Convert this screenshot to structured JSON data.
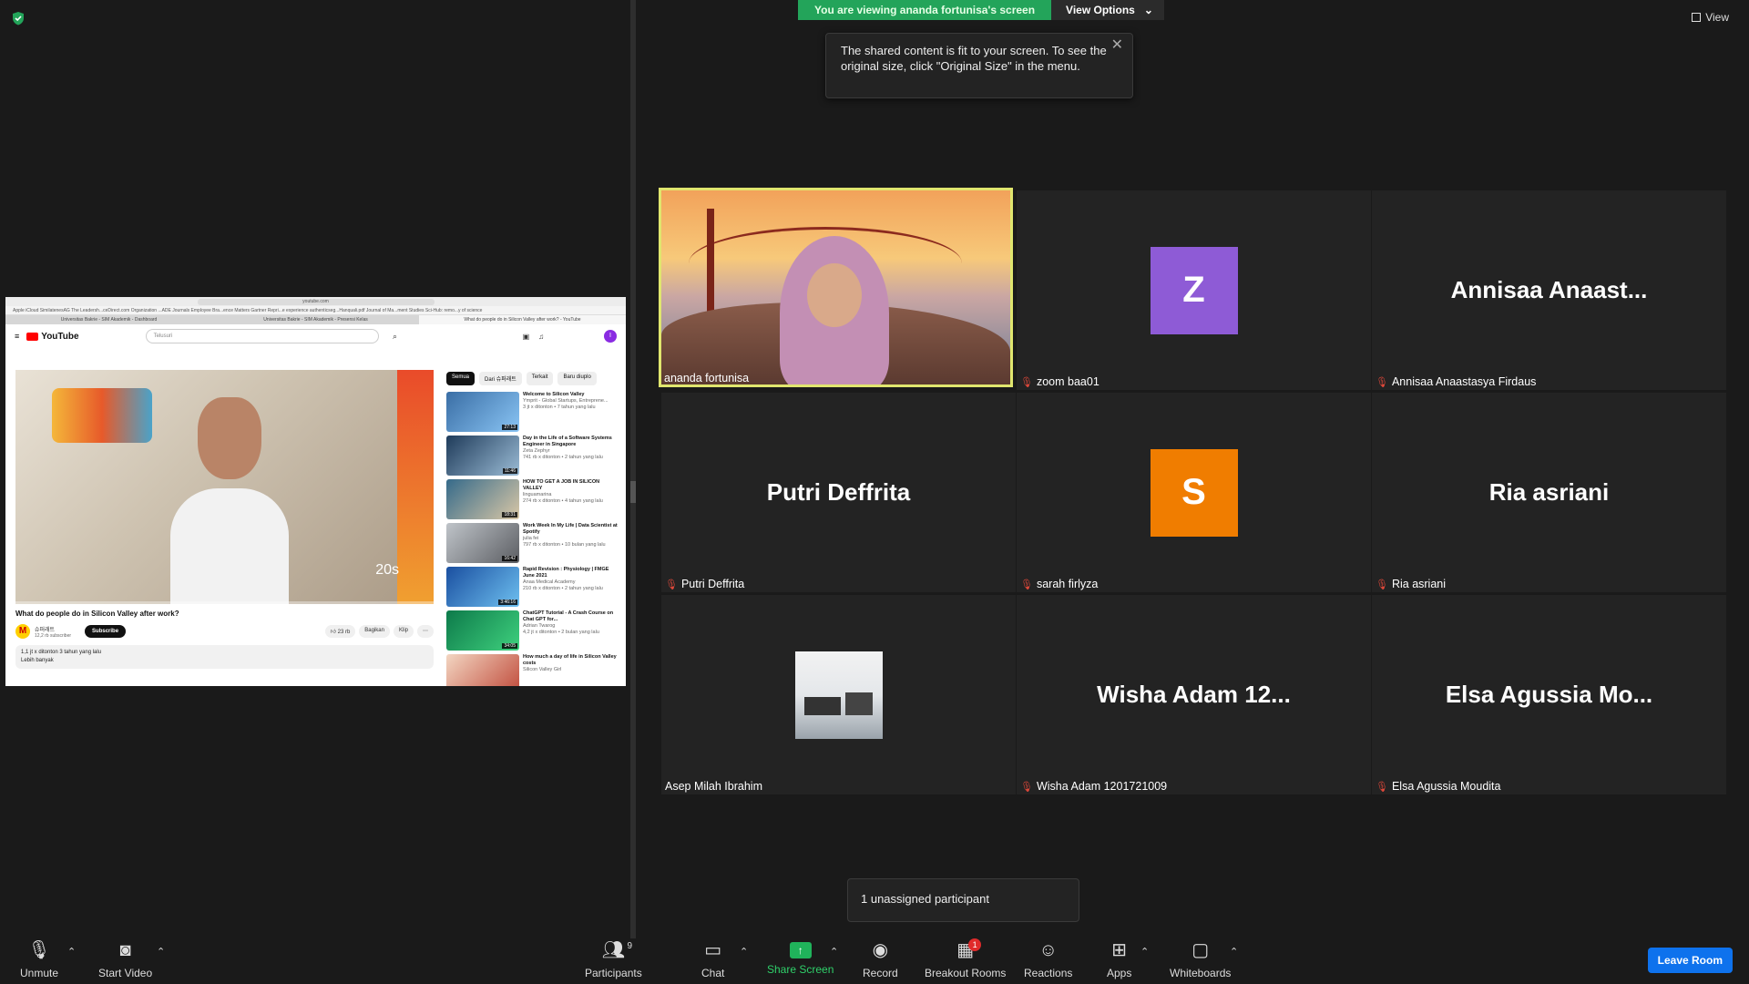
{
  "banner": {
    "viewing_text": "You are viewing ananda fortunisa's screen",
    "view_options_label": "View Options",
    "view_label": "View"
  },
  "tooltip": {
    "text": "The shared content is fit to your screen. To see the original size, click \"Original Size\" in the menu."
  },
  "shared_screen": {
    "url": "youtube.com",
    "bookmarks": "Apple   iCloud   SimilatenesAG   The Leadersh...ceDirect.com   Organization ...ADE Journals   Employee Bra...ence Matters   Gartner Repri...e experience   authenticseg...Hanquali.pdf   Journal of Ma...ment Studies   Sci-Hub: remo...y of science",
    "tabs": [
      "Universitas Bakrie - SIM Akademik - Dashboard",
      "Universitas Bakrie - SIM Akademik - Presensi Kelas",
      "What do people do in Silicon Valley after work? - YouTube"
    ],
    "yt_logo": "YouTube",
    "search_placeholder": "Telusuri",
    "avatar_letter": "I",
    "video_timer": "20s",
    "video_title": "What do people do in Silicon Valley after work?",
    "channel_name": "슈퍼래트",
    "channel_subs": "12,2 rb subscriber",
    "subscribe_label": "Subscribe",
    "likes": "23 rb",
    "share_label": "Bagikan",
    "clip_label": "Klip",
    "views_line": "1,1 jt x ditonton  3 tahun yang lalu",
    "more_label": "Lebih banyak",
    "chips": [
      "Semua",
      "Dari 슈퍼래트",
      "Terkait",
      "Baru diuplo"
    ],
    "recommendations": [
      {
        "title": "Welcome to Silicon Valley",
        "channel": "Ymprit - Global Startups, Entreprene...",
        "meta": "3 jt x ditonton • 7 tahun yang lalu",
        "duration": "27:13"
      },
      {
        "title": "Day in the Life of a Software Systems Engineer in Singapore",
        "channel": "Zeta Zephyr",
        "meta": "741 rb x ditonton • 2 tahun yang lalu",
        "duration": "11:46"
      },
      {
        "title": "HOW TO GET A JOB IN SILICON VALLEY",
        "channel": "linguamarina",
        "meta": "274 rb x ditonton • 4 tahun yang lalu",
        "duration": "18:31"
      },
      {
        "title": "Work Week In My Life | Data Scientist at Spotify",
        "channel": "julia fei",
        "meta": "797 rb x ditonton • 10 bulan yang lalu",
        "duration": "16:42"
      },
      {
        "title": "Rapid Revision : Physiology | FMGE June 2021",
        "channel": "Anaa Medical Academy",
        "meta": "210 rb x ditonton • 2 tahun yang lalu",
        "duration": "3:46:16"
      },
      {
        "title": "ChatGPT Tutorial - A Crash Course on Chat GPT for...",
        "channel": "Adrian Twarog",
        "meta": "4,2 jt x ditonton • 2 bulan yang lalu",
        "duration": "34:05"
      },
      {
        "title": "How much a day of life in Silicon Valley costs",
        "channel": "Silicon Valley Girl",
        "meta": "",
        "duration": ""
      }
    ]
  },
  "participants": [
    {
      "display": "",
      "name": "ananda fortunisa",
      "type": "camera",
      "muted": false
    },
    {
      "display": "Z",
      "name": "zoom baa01",
      "type": "avatar",
      "color": "#8e5bd6",
      "muted": true
    },
    {
      "display": "Annisaa  Anaast...",
      "name": "Annisaa Anaastasya Firdaus",
      "type": "text",
      "muted": true
    },
    {
      "display": "Putri Deffrita",
      "name": "Putri Deffrita",
      "type": "text",
      "muted": true
    },
    {
      "display": "S",
      "name": "sarah firlyza",
      "type": "avatar",
      "color": "#f07d00",
      "muted": true
    },
    {
      "display": "Ria asriani",
      "name": "Ria asriani",
      "type": "text",
      "muted": true
    },
    {
      "display": "",
      "name": "Asep Milah Ibrahim",
      "type": "photo",
      "muted": false
    },
    {
      "display": "Wisha Adam 12...",
      "name": "Wisha Adam 1201721009",
      "type": "text",
      "muted": true
    },
    {
      "display": "Elsa Agussia Mo...",
      "name": "Elsa Agussia Moudita",
      "type": "text",
      "muted": true
    }
  ],
  "unassigned": "1 unassigned participant",
  "toolbar": {
    "unmute": "Unmute",
    "start_video": "Start Video",
    "participants": "Participants",
    "participants_count": "9",
    "chat": "Chat",
    "share_screen": "Share Screen",
    "record": "Record",
    "breakout_rooms": "Breakout Rooms",
    "breakout_badge": "1",
    "reactions": "Reactions",
    "apps": "Apps",
    "whiteboards": "Whiteboards",
    "leave": "Leave Room"
  },
  "colors": {
    "accent_green": "#23a45a",
    "active_speaker": "#e0e66e",
    "leave_blue": "#0e72ed",
    "muted_red": "#e0483a"
  }
}
